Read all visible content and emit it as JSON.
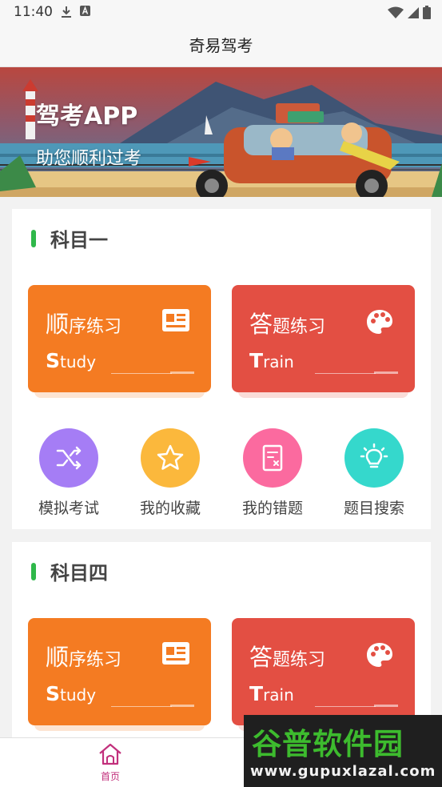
{
  "status_bar": {
    "time": "11:40"
  },
  "header": {
    "title": "奇易驾考"
  },
  "banner": {
    "title": "驾考APP",
    "subtitle": "助您顺利过考"
  },
  "sections": [
    {
      "title": "科目一",
      "cards": [
        {
          "title_first": "顺",
          "title_rest": "序练习",
          "sub_first": "S",
          "sub_rest": "tudy",
          "icon": "news-card-icon",
          "color": "#f47b22"
        },
        {
          "title_first": "答",
          "title_rest": "题练习",
          "sub_first": "T",
          "sub_rest": "rain",
          "icon": "palette-icon",
          "color": "#e34f43"
        }
      ],
      "quick_actions": [
        {
          "label": "模拟考试",
          "icon": "shuffle-icon",
          "color": "#a57df5"
        },
        {
          "label": "我的收藏",
          "icon": "star-icon",
          "color": "#fbb83c"
        },
        {
          "label": "我的错题",
          "icon": "document-x-icon",
          "color": "#fb6a9f"
        },
        {
          "label": "题目搜索",
          "icon": "lightbulb-icon",
          "color": "#35d8cc"
        }
      ]
    },
    {
      "title": "科目四",
      "cards": [
        {
          "title_first": "顺",
          "title_rest": "序练习",
          "sub_first": "S",
          "sub_rest": "tudy",
          "icon": "news-card-icon",
          "color": "#f47b22"
        },
        {
          "title_first": "答",
          "title_rest": "题练习",
          "sub_first": "T",
          "sub_rest": "rain",
          "icon": "palette-icon",
          "color": "#e34f43"
        }
      ]
    }
  ],
  "bottom_nav": {
    "items": [
      {
        "label": "首页",
        "icon": "home-icon",
        "active": true
      }
    ]
  },
  "watermark": {
    "title": "谷普软件园",
    "url": "www.gupuxlazal.com"
  }
}
